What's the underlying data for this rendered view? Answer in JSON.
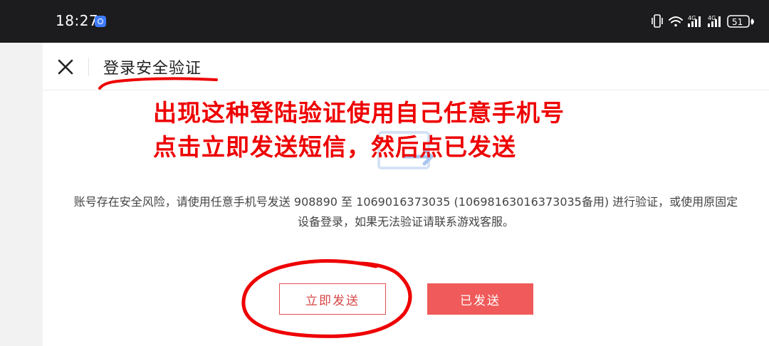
{
  "status_bar": {
    "time": "18:27",
    "battery": "51",
    "network_labels": [
      "4G",
      "4G"
    ]
  },
  "header": {
    "title": "登录安全验证"
  },
  "main": {
    "message": "账号存在安全风险，请使用任意手机号发送 908890 至 1069016373035 (10698163016373035备用) 进行验证，或使用原固定设备登录，如果无法验证请联系游戏客服。",
    "send_now_label": "立即发送",
    "sent_label": "已发送"
  },
  "annotation": {
    "line1": "出现这种登陆验证使用自己任意手机号",
    "line2": "点击立即发送短信，然后点已发送"
  },
  "icons": [
    "message-transfer-icon",
    "close-icon",
    "vibrate-icon",
    "wifi-icon",
    "signal-icon",
    "battery-icon"
  ],
  "colors": {
    "accent": "#f05a5a",
    "annotation": "#ee0000",
    "status_bar": "#1c1c1e"
  }
}
